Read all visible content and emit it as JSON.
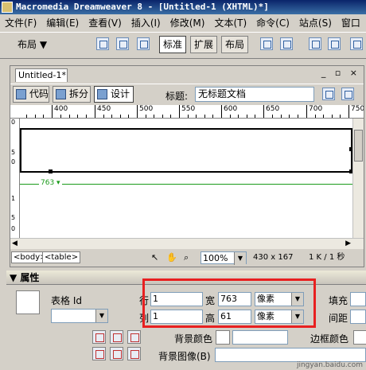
{
  "titlebar": {
    "title": "Macromedia Dreamweaver 8 - [Untitled-1 (XHTML)*]"
  },
  "menu": [
    "文件(F)",
    "编辑(E)",
    "查看(V)",
    "插入(I)",
    "修改(M)",
    "文本(T)",
    "命令(C)",
    "站点(S)",
    "窗口"
  ],
  "toolbar": {
    "layout_dropdown": "布局",
    "seg_standard": "标准",
    "seg_expanded": "扩展",
    "seg_layout": "布局"
  },
  "document": {
    "tab": "Untitled-1*",
    "view_code": "代码",
    "view_split": "拆分",
    "view_design": "设计",
    "title_label": "标题:",
    "title_value": "无标题文档",
    "ruler_labels": [
      "400",
      "450",
      "500",
      "550",
      "600",
      "650",
      "700",
      "750"
    ],
    "vruler_labels": [
      "0",
      "5",
      "0",
      "1",
      "5",
      "0"
    ],
    "table_width_label": "763"
  },
  "statusbar": {
    "tag_body": "<body>",
    "tag_table": "<table>",
    "zoom": "100%",
    "window_size": "430 x 167",
    "file_size": "1 K / 1 秒"
  },
  "properties": {
    "header": "属性",
    "table_label": "表格 Id",
    "rows_label": "行",
    "rows_value": "1",
    "cols_label": "列",
    "cols_value": "1",
    "width_label": "宽",
    "width_value": "763",
    "width_unit": "像素",
    "height_label": "高",
    "height_value": "61",
    "height_unit": "像素",
    "padding_label": "填充",
    "spacing_label": "间距",
    "bg_color_label": "背景颜色",
    "bg_image_label": "背景图像(B)",
    "border_color_label": "边框颜色"
  },
  "watermark": "jingyan.baidu.com"
}
